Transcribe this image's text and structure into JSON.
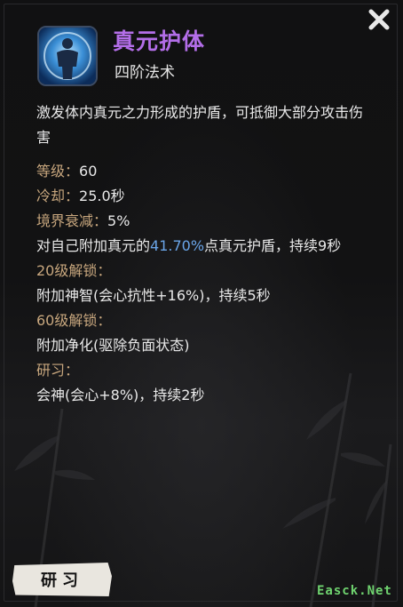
{
  "skill": {
    "name": "真元护体",
    "tier": "四阶法术",
    "description": "激发体内真元之力形成的护盾，可抵御大部分攻击伤害"
  },
  "stats": {
    "level_label": "等级：",
    "level_value": "60",
    "cooldown_label": "冷却：",
    "cooldown_value": "25.0秒",
    "decay_label": "境界衰减：",
    "decay_value": "5%"
  },
  "effect": {
    "prefix": "对自己附加真元的",
    "percent": "41.70%",
    "suffix": "点真元护盾，持续9秒"
  },
  "unlocks": [
    {
      "label": "20级解锁：",
      "text": "附加神智(会心抗性+16%)，持续5秒"
    },
    {
      "label": "60级解锁：",
      "text": "附加净化(驱除负面状态)"
    }
  ],
  "study": {
    "label": "研习：",
    "text": "会神(会心+8%)，持续2秒",
    "button_label": "研习"
  },
  "watermark": "Easck.Net",
  "icons": {
    "close": "close-x-icon",
    "skill": "shield-body-icon"
  },
  "colors": {
    "title": "#b36ee8",
    "key": "#c8a77e",
    "highlight": "#6aa5e8",
    "watermark": "#6fd36f"
  }
}
